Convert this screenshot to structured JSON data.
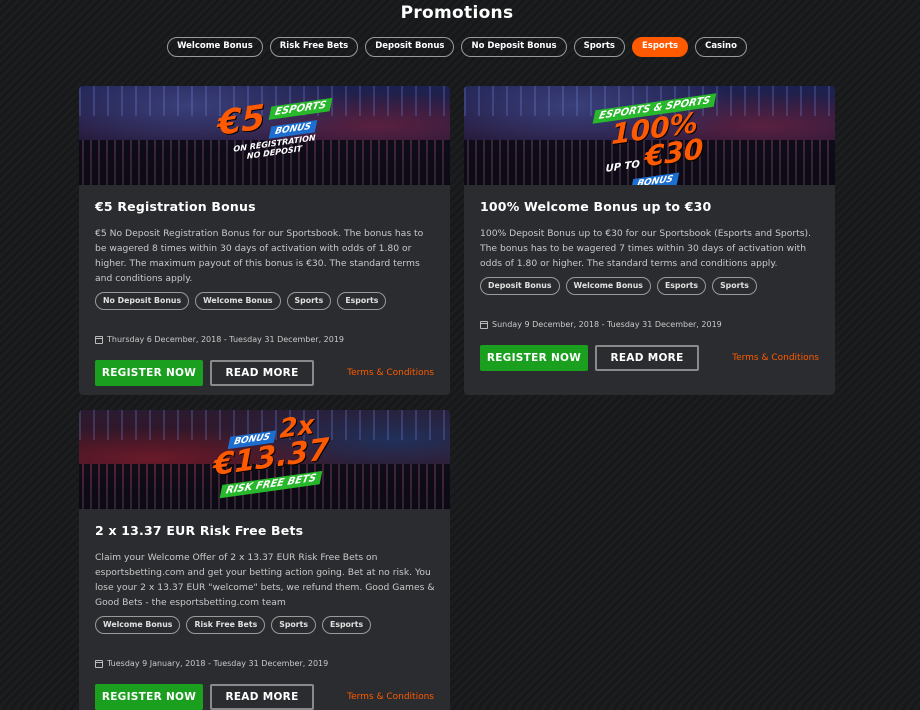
{
  "page": {
    "title": "Promotions"
  },
  "filters": [
    {
      "label": "Welcome Bonus",
      "active": false
    },
    {
      "label": "Risk Free Bets",
      "active": false
    },
    {
      "label": "Deposit Bonus",
      "active": false
    },
    {
      "label": "No Deposit Bonus",
      "active": false
    },
    {
      "label": "Sports",
      "active": false
    },
    {
      "label": "Esports",
      "active": true
    },
    {
      "label": "Casino",
      "active": false
    }
  ],
  "cards": [
    {
      "banner": {
        "line1": "€5",
        "line2": "ESPORTS",
        "line3": "BONUS",
        "line4": "ON REGISTRATION",
        "line5": "NO DEPOSIT"
      },
      "title": "€5 Registration Bonus",
      "description": "€5 No Deposit Registration Bonus for our Sportsbook. The bonus has to be wagered 8 times within 30 days of activation with odds of 1.80 or higher. The maximum payout of this bonus is €30. The standard terms and conditions apply.",
      "tags": [
        "No Deposit Bonus",
        "Welcome Bonus",
        "Sports",
        "Esports"
      ],
      "dates": "Thursday 6 December, 2018 - Tuesday 31 December, 2019",
      "register_label": "REGISTER NOW",
      "readmore_label": "READ MORE",
      "terms_label": "Terms & Conditions"
    },
    {
      "banner": {
        "line1": "ESPORTS & SPORTS",
        "line2": "100%",
        "line3": "UP TO",
        "line4": "€30",
        "line5": "BONUS"
      },
      "title": "100% Welcome Bonus up to €30",
      "description": "100% Deposit Bonus up to €30 for our Sportsbook (Esports and Sports). The bonus has to be wagered 7 times within 30 days of activation with odds of 1.80 or higher. The standard terms and conditions apply.",
      "tags": [
        "Deposit Bonus",
        "Welcome Bonus",
        "Esports",
        "Sports"
      ],
      "dates": "Sunday 9 December, 2018 - Tuesday 31 December, 2019",
      "register_label": "REGISTER NOW",
      "readmore_label": "READ MORE",
      "terms_label": "Terms & Conditions"
    },
    {
      "banner": {
        "line1": "BONUS",
        "line2": "2x",
        "line3": "€13.37",
        "line4": "RISK FREE BETS"
      },
      "title": "2 x 13.37 EUR Risk Free Bets",
      "description": "Claim your Welcome Offer of 2 x 13.37 EUR Risk Free Bets on esportsbetting.com and get your betting action going. Bet at no risk. You lose your 2 x 13.37 EUR \"welcome\" bets, we refund them. Good Games & Good Bets - the esportsbetting.com team",
      "tags": [
        "Welcome Bonus",
        "Risk Free Bets",
        "Sports",
        "Esports"
      ],
      "dates": "Tuesday 9 January, 2018 - Tuesday 31 December, 2019",
      "register_label": "REGISTER NOW",
      "readmore_label": "READ MORE",
      "terms_label": "Terms & Conditions"
    }
  ],
  "colors": {
    "accent": "#ff5a00",
    "register": "#1a9f1f",
    "card_bg": "#2a2c2f"
  }
}
